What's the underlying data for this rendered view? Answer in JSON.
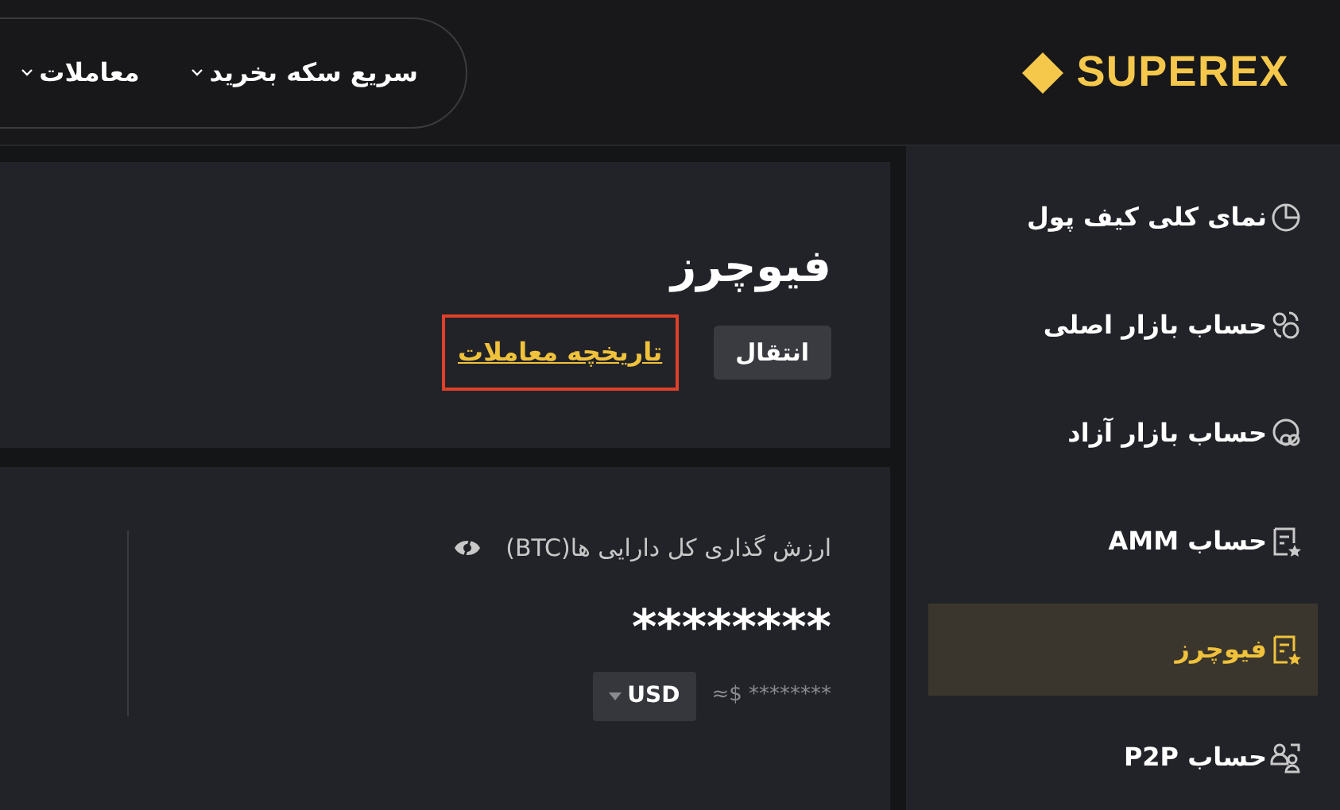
{
  "header": {
    "logo": "SUPEREX",
    "nav": [
      {
        "label": "سریع سکه بخرید"
      },
      {
        "label": "معاملات"
      }
    ]
  },
  "sidebar": {
    "items": [
      {
        "label": "نمای کلی کیف پول",
        "kind": "pie",
        "selected": false
      },
      {
        "label": "حساب بازار اصلی",
        "kind": "swap",
        "selected": false
      },
      {
        "label": "حساب بازار آزاد",
        "kind": "rings",
        "selected": false
      },
      {
        "label": "حساب AMM",
        "kind": "doc",
        "selected": false
      },
      {
        "label": "فیوچرز",
        "kind": "doc",
        "selected": true
      },
      {
        "label": "حساب P2P",
        "kind": "people",
        "selected": false
      }
    ]
  },
  "header_card": {
    "title": "فیوچرز",
    "transfer_button": "انتقال",
    "history_link": {
      "label": "تاریخچه معاملات",
      "highlighted": true
    }
  },
  "balance_card": {
    "label": "ارزش گذاری کل دارایی ها(BTC)",
    "value": "********",
    "approx": "≈$ ********",
    "currency": "USD"
  }
}
